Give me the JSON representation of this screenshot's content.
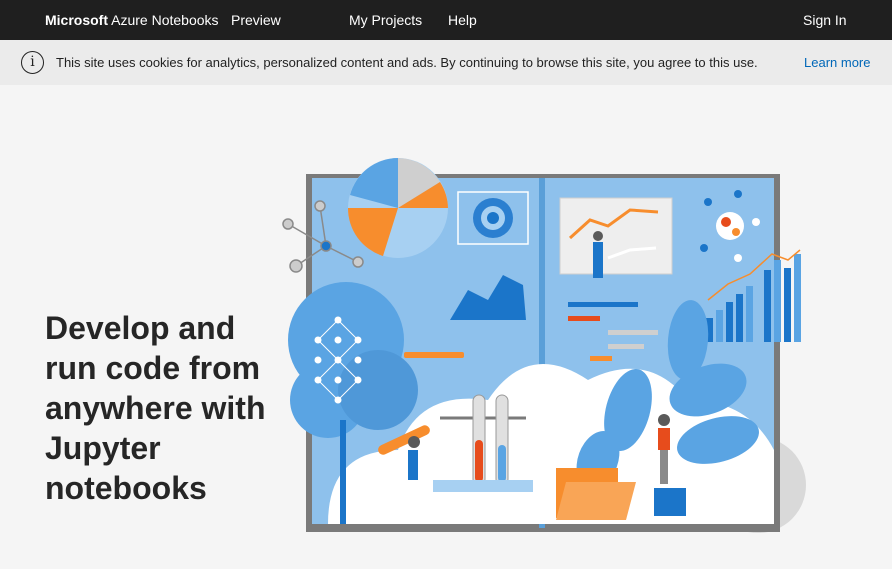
{
  "header": {
    "brand_bold": "Microsoft",
    "brand_rest": "Azure Notebooks",
    "preview": "Preview",
    "my_projects": "My Projects",
    "help": "Help",
    "sign_in": "Sign In"
  },
  "cookie_banner": {
    "info_icon": "i",
    "message": "This site uses cookies for analytics, personalized content and ads. By continuing to browse this site, you agree to this use.",
    "learn_more": "Learn more"
  },
  "hero": {
    "title": "Develop and run code from anywhere with Jupyter notebooks"
  },
  "colors": {
    "topbar": "#1f1f1f",
    "banner": "#ebebeb",
    "link": "#0067b8",
    "accent_orange": "#f78d2d",
    "accent_blue": "#1b75c9"
  }
}
